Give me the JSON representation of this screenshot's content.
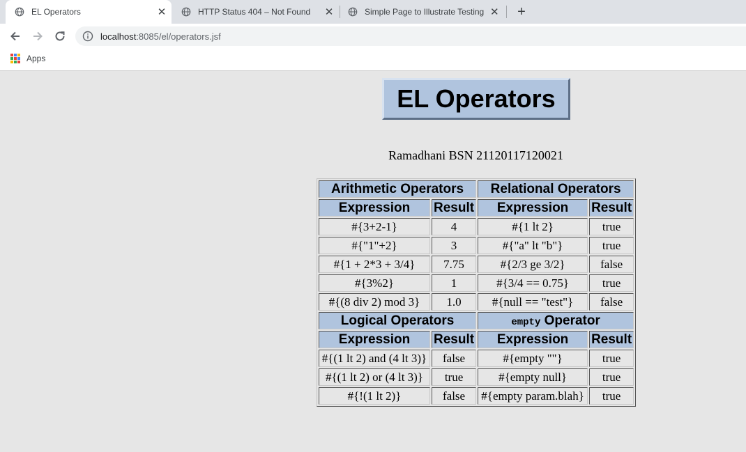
{
  "browser": {
    "tabs": [
      {
        "title": "EL Operators"
      },
      {
        "title": "HTTP Status 404 – Not Found"
      },
      {
        "title": "Simple Page to Illustrate Testing f"
      }
    ],
    "new_tab_symbol": "+",
    "close_symbol": "✕",
    "address": {
      "host": "localhost",
      "path": ":8085/el/operators.jsf"
    },
    "bookmarks": {
      "apps_label": "Apps"
    }
  },
  "page": {
    "heading": "EL Operators",
    "author": "Ramadhani BSN 21120117120021",
    "sections": {
      "arithmetic": "Arithmetic Operators",
      "relational": "Relational Operators",
      "logical": "Logical Operators",
      "empty_code": "empty",
      "empty_suffix": " Operator"
    },
    "col_expression": "Expression",
    "col_result": "Result",
    "rows_top": [
      {
        "a_expr": "#{3+2-1}",
        "a_res": "4",
        "r_expr": "#{1 lt 2}",
        "r_res": "true"
      },
      {
        "a_expr": "#{\"1\"+2}",
        "a_res": "3",
        "r_expr": "#{\"a\" lt \"b\"}",
        "r_res": "true"
      },
      {
        "a_expr": "#{1 + 2*3 + 3/4}",
        "a_res": "7.75",
        "r_expr": "#{2/3 ge 3/2}",
        "r_res": "false"
      },
      {
        "a_expr": "#{3%2}",
        "a_res": "1",
        "r_expr": "#{3/4 == 0.75}",
        "r_res": "true"
      },
      {
        "a_expr": "#{(8 div 2) mod 3}",
        "a_res": "1.0",
        "r_expr": "#{null == \"test\"}",
        "r_res": "false"
      }
    ],
    "rows_bottom": [
      {
        "l_expr": "#{(1 lt 2) and (4 lt 3)}",
        "l_res": "false",
        "e_expr": "#{empty \"\"}",
        "e_res": "true"
      },
      {
        "l_expr": "#{(1 lt 2) or (4 lt 3)}",
        "l_res": "true",
        "e_expr": "#{empty null}",
        "e_res": "true"
      },
      {
        "l_expr": "#{!(1 lt 2)}",
        "l_res": "false",
        "e_expr": "#{empty param.blah}",
        "e_res": "true"
      }
    ]
  },
  "colors": {
    "header_bg": "#b0c4de",
    "page_bg": "#e6e6e6",
    "tabstrip_bg": "#dee1e6"
  },
  "icons": [
    "globe-icon",
    "close-icon",
    "new-tab-icon",
    "back-icon",
    "forward-icon",
    "reload-icon",
    "info-icon",
    "apps-grid-icon"
  ]
}
